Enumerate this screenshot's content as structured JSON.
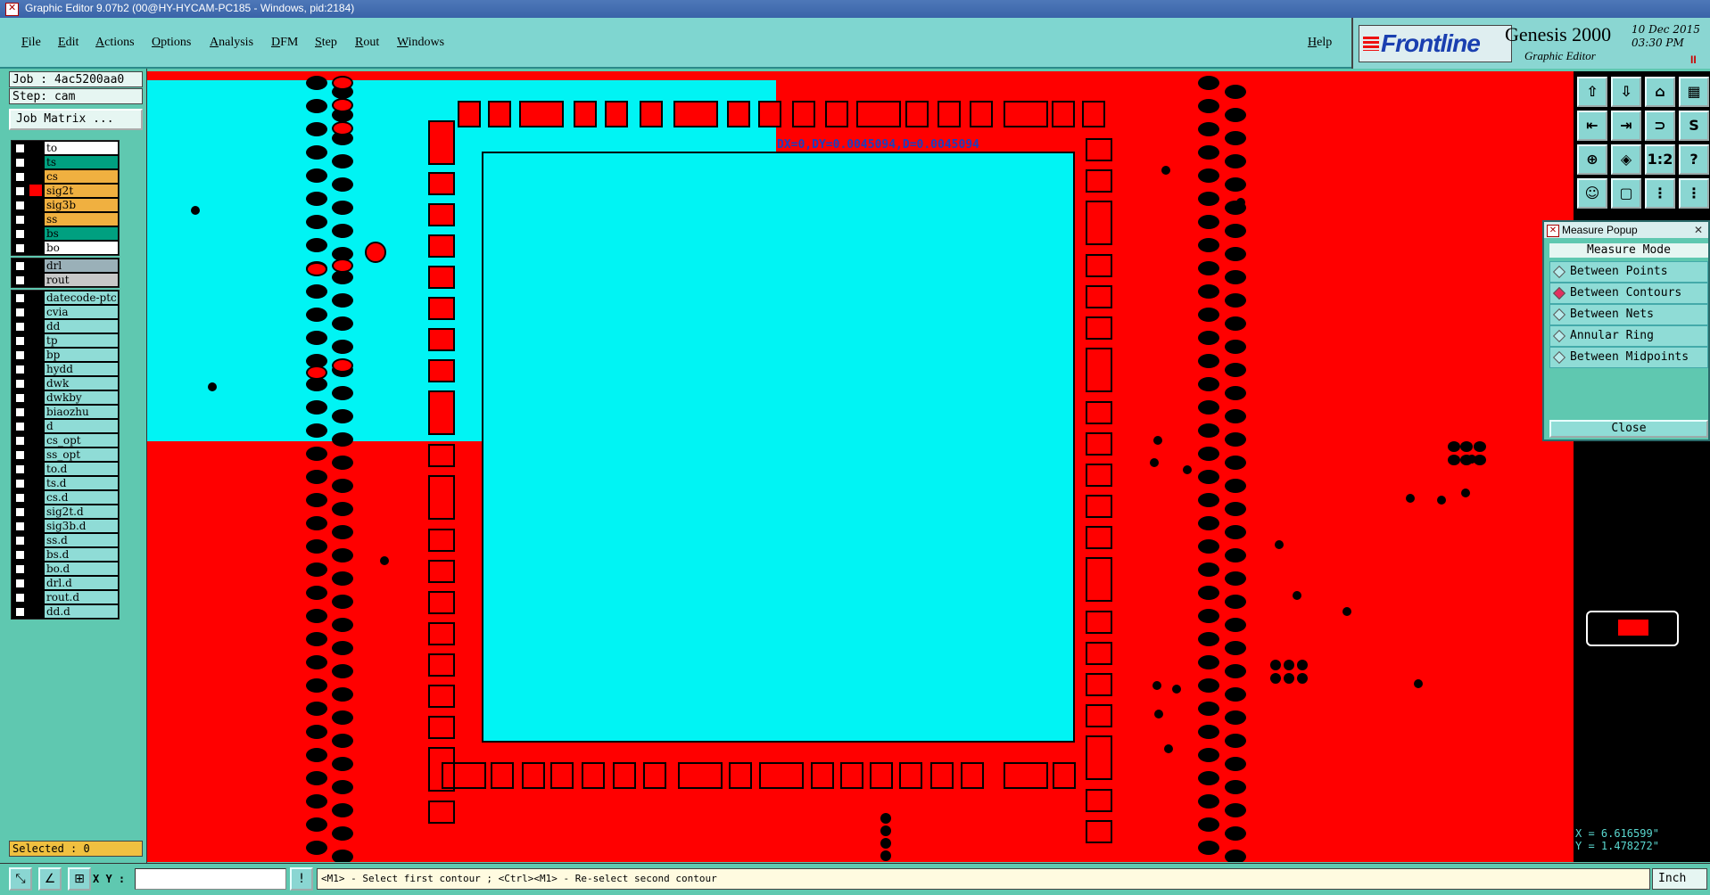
{
  "titlebar": {
    "title": "Graphic Editor 9.07b2 (00@HY-HYCAM-PC185 - Windows, pid:2184)"
  },
  "menu": {
    "items": [
      "File",
      "Edit",
      "Actions",
      "Options",
      "Analysis",
      "DFM",
      "Step",
      "Rout",
      "Windows"
    ],
    "help": "Help"
  },
  "brand": {
    "logo": "Frontline",
    "product": "Genesis 2000",
    "subtitle": "Graphic Editor",
    "date": "10  Dec  2015",
    "time": "03:30  PM"
  },
  "job": {
    "job": "Job : 4ac5200aa0",
    "step": "Step: cam",
    "matrix_button": "Job Matrix ..."
  },
  "layers": {
    "board": [
      {
        "name": "to",
        "color": "#000000",
        "bg": "#ffffff"
      },
      {
        "name": "ts",
        "color": "#000000",
        "bg": "#00a080"
      },
      {
        "name": "cs",
        "color": "#000000",
        "bg": "#f0b040"
      },
      {
        "name": "sig2t",
        "color": "#ff0000",
        "bg": "#f0b040"
      },
      {
        "name": "sig3b",
        "color": "#000000",
        "bg": "#f0b040"
      },
      {
        "name": "ss",
        "color": "#000000",
        "bg": "#f0b040"
      },
      {
        "name": "bs",
        "color": "#000000",
        "bg": "#00a080"
      },
      {
        "name": "bo",
        "color": "#000000",
        "bg": "#ffffff"
      }
    ],
    "drill": [
      {
        "name": "drl",
        "color": "#000000",
        "bg": "#9ab0b8"
      },
      {
        "name": "rout",
        "color": "#000000",
        "bg": "#c8c8c8"
      }
    ],
    "misc": [
      "datecode-ptc",
      "cvia",
      "dd",
      "tp",
      "bp",
      "hydd",
      "dwk",
      "dwkby",
      "biaozhu",
      "d",
      "cs_opt",
      "ss_opt",
      "to.d",
      "ts.d",
      "cs.d",
      "sig2t.d",
      "sig3b.d",
      "ss.d",
      "bs.d",
      "bo.d",
      "drl.d",
      "rout.d",
      "dd.d"
    ]
  },
  "selected": "Selected : 0",
  "canvas": {
    "measure_readout": "DX=0,DY=0.0045094,D=0.0045094"
  },
  "measure_popup": {
    "title": "Measure Popup",
    "header": "Measure Mode",
    "options": [
      {
        "label": "Between Points",
        "selected": false
      },
      {
        "label": "Between Contours",
        "selected": true
      },
      {
        "label": "Between Nets",
        "selected": false
      },
      {
        "label": "Annular Ring",
        "selected": false
      },
      {
        "label": "Between Midpoints",
        "selected": false
      }
    ],
    "close": "Close"
  },
  "toolbar": {
    "glyphs": [
      "⇧",
      "⇩",
      "⌂",
      "▦",
      "⇤",
      "⇥",
      "⊃",
      "S",
      "⊕",
      "◈",
      "1:2",
      "?",
      "☺",
      "▢",
      "⋮",
      "⋮"
    ]
  },
  "coords": {
    "x": "X = 6.616599\"",
    "y": "Y = 1.478272\""
  },
  "status": {
    "xy_label": "X Y :",
    "xy_value": "",
    "message": "<M1> - Select first contour ; <Ctrl><M1> - Re-select second contour",
    "units": "Inch"
  }
}
